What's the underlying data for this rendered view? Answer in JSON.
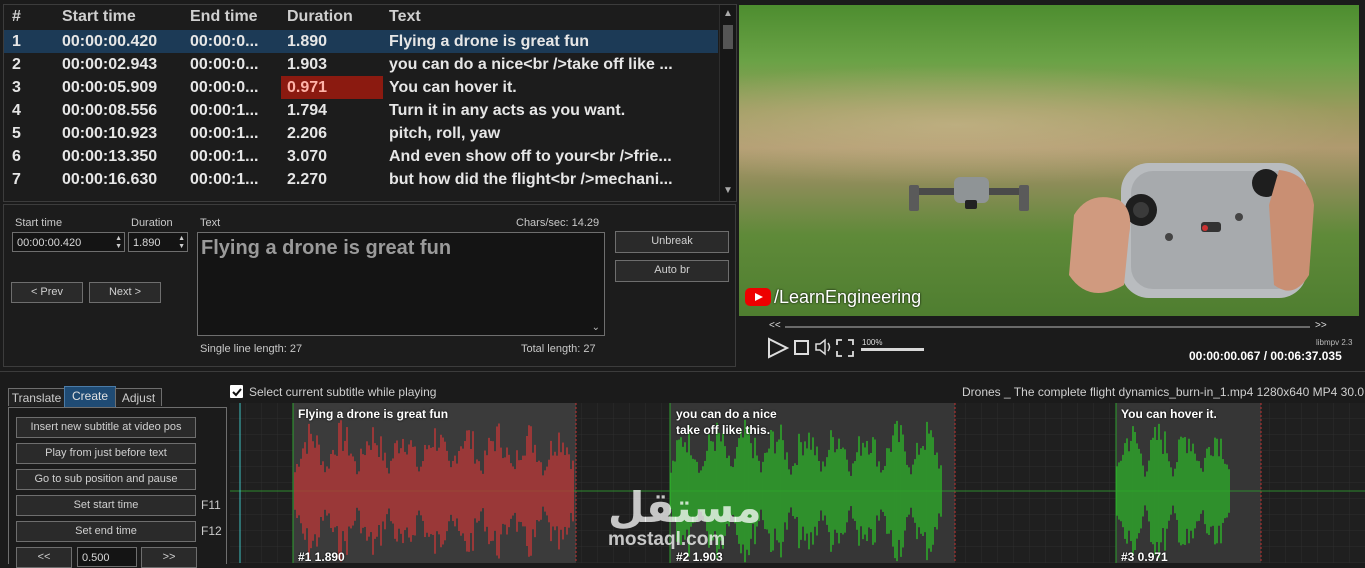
{
  "grid": {
    "headers": [
      "#",
      "Start time",
      "End time",
      "Duration",
      "Text"
    ],
    "rows": [
      {
        "num": "1",
        "start": "00:00:00.420",
        "end": "00:00:0...",
        "duration": "1.890",
        "text": "Flying a drone is great fun"
      },
      {
        "num": "2",
        "start": "00:00:02.943",
        "end": "00:00:0...",
        "duration": "1.903",
        "text": "you can do a nice<br />take off like ..."
      },
      {
        "num": "3",
        "start": "00:00:05.909",
        "end": "00:00:0...",
        "duration": "0.971",
        "text": "You can hover it."
      },
      {
        "num": "4",
        "start": "00:00:08.556",
        "end": "00:00:1...",
        "duration": "1.794",
        "text": "Turn it in any acts as you want."
      },
      {
        "num": "5",
        "start": "00:00:10.923",
        "end": "00:00:1...",
        "duration": "2.206",
        "text": "pitch, roll, yaw"
      },
      {
        "num": "6",
        "start": "00:00:13.350",
        "end": "00:00:1...",
        "duration": "3.070",
        "text": "And even show off to your<br />frie..."
      },
      {
        "num": "7",
        "start": "00:00:16.630",
        "end": "00:00:1...",
        "duration": "2.270",
        "text": "but how did the flight<br />mechani..."
      }
    ]
  },
  "editor": {
    "start_time_label": "Start time",
    "start_time_value": "00:00:00.420",
    "duration_label": "Duration",
    "duration_value": "1.890",
    "text_label": "Text",
    "chars_per_sec": "Chars/sec: 14.29",
    "text_value": "Flying a drone is great fun",
    "unbreak": "Unbreak",
    "auto_br": "Auto br",
    "prev": "< Prev",
    "next": "Next >",
    "single_line_length": "Single line length: 27",
    "total_length": "Total length: 27"
  },
  "video": {
    "watermark": "/LearnEngineering",
    "volume_label": "100%",
    "engine": "libmpv 2.3",
    "time": "00:00:00.067 / 00:06:37.035",
    "rewind_icon": "<<",
    "forward_icon": ">>"
  },
  "waveform": {
    "select_while_playing": "Select current subtitle while playing",
    "file_info": "Drones _ The complete flight dynamics_burn-in_1.mp4 1280x640 MP4 30.0",
    "segments": [
      {
        "line1": "Flying a drone is great fun",
        "line2": "",
        "tag": "#1  1.890",
        "color": "#b33838"
      },
      {
        "line1": "you can do a nice",
        "line2": "take off like this.",
        "tag": "#2  1.903",
        "color": "#2ea82a"
      },
      {
        "line1": "You can hover it.",
        "line2": "",
        "tag": "#3  0.971",
        "color": "#2ea82a"
      }
    ],
    "brand_ar": "مستقل",
    "brand_en": "mostaql.com"
  },
  "tabs": [
    "Translate",
    "Create",
    "Adjust"
  ],
  "create_panel": {
    "insert": "Insert new subtitle at video pos",
    "play_before": "Play from just before text",
    "goto_pause": "Go to sub position and pause",
    "set_start": "Set start time",
    "set_start_key": "F11",
    "set_end": "Set end time",
    "set_end_key": "F12",
    "back": "<<",
    "step": "0.500",
    "fwd": ">>"
  },
  "colors": {
    "selected_row": "#1c3a56",
    "error_cell": "#8b1a10",
    "active_tab": "#1f4b74"
  }
}
